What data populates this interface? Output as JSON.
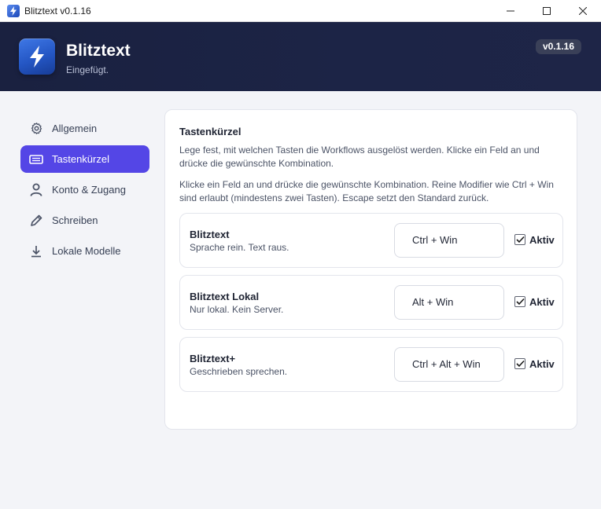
{
  "window": {
    "title": "Blitztext v0.1.16"
  },
  "header": {
    "app_name": "Blitztext",
    "status": "Eingefügt.",
    "version": "v0.1.16"
  },
  "sidebar": {
    "items": [
      {
        "label": "Allgemein",
        "icon": "gear-icon",
        "active": false
      },
      {
        "label": "Tastenkürzel",
        "icon": "keyboard-icon",
        "active": true
      },
      {
        "label": "Konto & Zugang",
        "icon": "user-icon",
        "active": false
      },
      {
        "label": "Schreiben",
        "icon": "pencil-icon",
        "active": false
      },
      {
        "label": "Lokale Modelle",
        "icon": "download-icon",
        "active": false
      }
    ]
  },
  "panel": {
    "title": "Tastenkürzel",
    "desc1": "Lege fest, mit welchen Tasten die Workflows ausgelöst werden. Klicke ein Feld an und drücke die gewünschte Kombination.",
    "desc2": "Klicke ein Feld an und drücke die gewünschte Kombination. Reine Modifier wie Ctrl + Win sind erlaubt (mindestens zwei Tasten). Escape setzt den Standard zurück.",
    "rows": [
      {
        "name": "Blitztext",
        "sub": "Sprache rein. Text raus.",
        "hotkey": "Ctrl + Win",
        "active_label": "Aktiv",
        "checked": true
      },
      {
        "name": "Blitztext Lokal",
        "sub": "Nur lokal. Kein Server.",
        "hotkey": "Alt + Win",
        "active_label": "Aktiv",
        "checked": true
      },
      {
        "name": "Blitztext+",
        "sub": "Geschrieben sprechen.",
        "hotkey": "Ctrl + Alt + Win",
        "active_label": "Aktiv",
        "checked": true
      }
    ]
  },
  "colors": {
    "accent": "#5446e6",
    "header_bg": "#1a2140",
    "background": "#f3f4f8"
  }
}
